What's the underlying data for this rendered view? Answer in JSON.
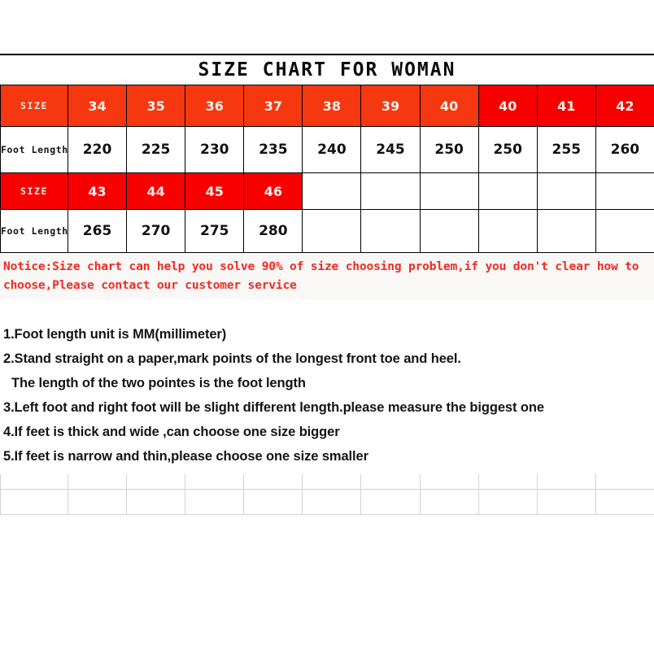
{
  "chart_data": {
    "type": "table",
    "title": "SIZE CHART FOR WOMAN",
    "row_headers": [
      "SIZE",
      "Foot Length",
      "SIZE",
      "Foot Length"
    ],
    "blocks": [
      {
        "size_label": "SIZE",
        "sizes": [
          "34",
          "35",
          "36",
          "37",
          "38",
          "39",
          "40",
          "40",
          "41",
          "42"
        ],
        "length_label": "Foot Length",
        "lengths": [
          "220",
          "225",
          "230",
          "235",
          "240",
          "245",
          "250",
          "250",
          "255",
          "260"
        ],
        "header_colors": [
          "#f5380f",
          "#f5380f",
          "#f5380f",
          "#f5380f",
          "#f5380f",
          "#f5380f",
          "#f5380f",
          "#f80000",
          "#f80000",
          "#f80000"
        ]
      },
      {
        "size_label": "SIZE",
        "sizes": [
          "43",
          "44",
          "45",
          "46",
          "",
          "",
          "",
          "",
          "",
          ""
        ],
        "length_label": "Foot Length",
        "lengths": [
          "265",
          "270",
          "275",
          "280",
          "",
          "",
          "",
          "",
          "",
          ""
        ],
        "header_colors": [
          "#f80000",
          "#f80000",
          "#f80000",
          "#f80000",
          "#ffffff",
          "#ffffff",
          "#ffffff",
          "#ffffff",
          "#ffffff",
          "#ffffff"
        ]
      }
    ],
    "unit": "MM",
    "colors": {
      "header_orange": "#f5380f",
      "header_red": "#f80000",
      "notice_text": "#f22b22",
      "notice_background": "#faf7f7",
      "border": "#000000",
      "grid_faint": "#d2d2d2"
    }
  },
  "notice": {
    "text": "Notice:Size chart can help you solve 90% of size choosing problem,if you don't clear how to choose,Please contact our customer service"
  },
  "instructions": {
    "lines": [
      "1.Foot length unit is MM(millimeter)",
      "2.Stand straight on a paper,mark points of the longest front toe and heel.",
      "The length of the two pointes is the foot length",
      "3.Left foot and right foot will be slight different length.please measure the biggest one",
      "4.If feet is thick and wide ,can choose one size bigger",
      "5.If feet is narrow and thin,please choose one size smaller"
    ]
  }
}
